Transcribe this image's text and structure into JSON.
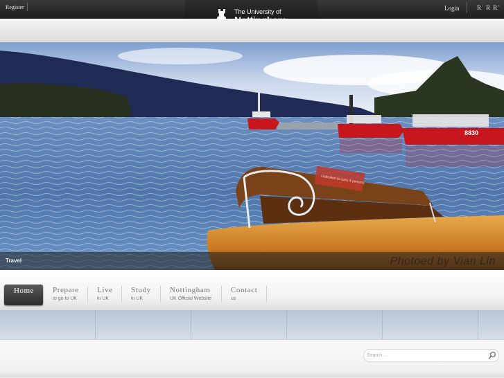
{
  "topbar": {
    "register_label": "Register",
    "login_label": "Login",
    "font_size_controls": [
      "R",
      "R",
      "R"
    ]
  },
  "logo": {
    "line1": "The University of",
    "line2": "Nottingham"
  },
  "hero": {
    "caption": "Travel",
    "credit": "Photoed by Vian Lin",
    "boat_sign": "Unbroken to carry 4 persons",
    "boat_number": "8830"
  },
  "nav": {
    "items": [
      {
        "label": "Home",
        "sub": ""
      },
      {
        "label": "Prepare",
        "sub": "to go to UK"
      },
      {
        "label": "Live",
        "sub": "in UK"
      },
      {
        "label": "Study",
        "sub": "in UK"
      },
      {
        "label": "Nottingham",
        "sub": "UK Official Website"
      },
      {
        "label": "Contact",
        "sub": "us"
      }
    ]
  },
  "search": {
    "placeholder": "Search ..."
  },
  "colors": {
    "topbar": "#262626",
    "boat_red": "#c8161d",
    "water": "#5f86b8"
  }
}
